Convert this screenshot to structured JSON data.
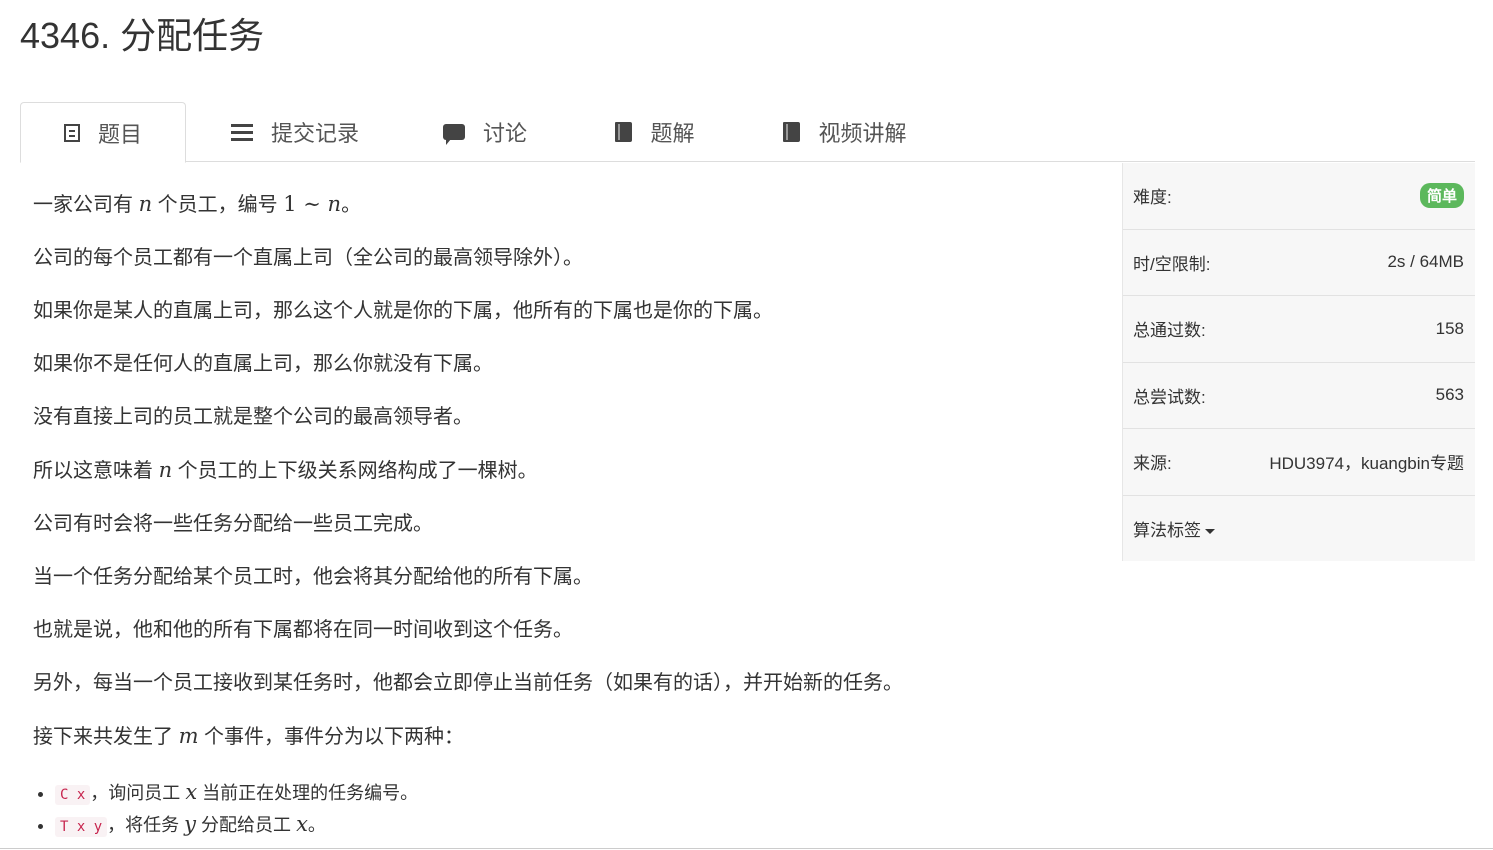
{
  "problem": {
    "title": "4346. 分配任务"
  },
  "tabs": [
    {
      "label": "题目",
      "icon": "document-icon",
      "active": true
    },
    {
      "label": "提交记录",
      "icon": "list-icon"
    },
    {
      "label": "讨论",
      "icon": "comment-icon"
    },
    {
      "label": "题解",
      "icon": "book-icon"
    },
    {
      "label": "视频讲解",
      "icon": "book-icon"
    }
  ],
  "description": {
    "p1": {
      "a": "一家公司有 ",
      "n1": "n",
      "b": " 个员工，编号 ",
      "range": "1 ∼ ",
      "n2": "n",
      "c": "。"
    },
    "p2": "公司的每个员工都有一个直属上司（全公司的最高领导除外）。",
    "p3": "如果你是某人的直属上司，那么这个人就是你的下属，他所有的下属也是你的下属。",
    "p4": "如果你不是任何人的直属上司，那么你就没有下属。",
    "p5": "没有直接上司的员工就是整个公司的最高领导者。",
    "p6": {
      "a": "所以这意味着 ",
      "n": "n",
      "b": " 个员工的上下级关系网络构成了一棵树。"
    },
    "p7": "公司有时会将一些任务分配给一些员工完成。",
    "p8": "当一个任务分配给某个员工时，他会将其分配给他的所有下属。",
    "p9": "也就是说，他和他的所有下属都将在同一时间收到这个任务。",
    "p10": "另外，每当一个员工接收到某任务时，他都会立即停止当前任务（如果有的话），并开始新的任务。",
    "p11": {
      "a": "接下来共发生了 ",
      "m": "m",
      "b": " 个事件，事件分为以下两种："
    },
    "events": [
      {
        "code": "C x",
        "a": "，询问员工 ",
        "v1": "x",
        "b": " 当前正在处理的任务编号。"
      },
      {
        "code": "T x y",
        "a": "，将任务 ",
        "v1": "y",
        "b": " 分配给员工 ",
        "v2": "x",
        "c": "。"
      }
    ]
  },
  "sidebar": {
    "difficulty_label": "难度:",
    "difficulty_value": "简单",
    "limit_label": "时/空限制:",
    "limit_value": "2s / 64MB",
    "passed_label": "总通过数:",
    "passed_value": "158",
    "tried_label": "总尝试数:",
    "tried_value": "563",
    "source_label": "来源:",
    "source_value": "HDU3974，kuangbin专题",
    "tags_label": "算法标签"
  },
  "colors": {
    "badge_easy": "#5cb85c",
    "code_text": "#c7254e",
    "code_bg": "#f9f2f4"
  }
}
